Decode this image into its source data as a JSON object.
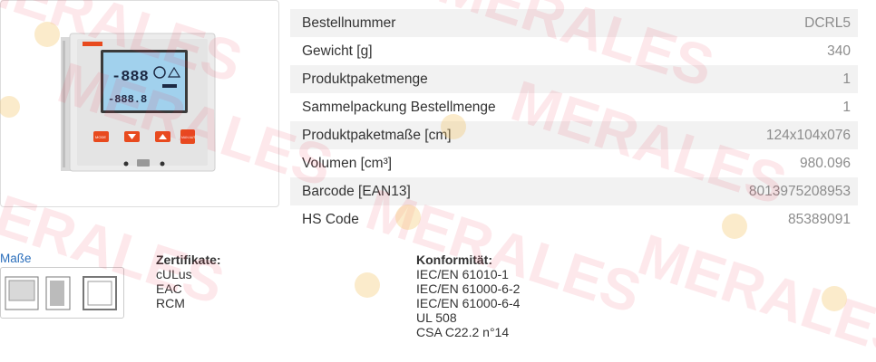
{
  "product_image": {
    "icon": "rcd-controller-device-image"
  },
  "specs": [
    {
      "label": "Bestellnummer",
      "value": "DCRL5"
    },
    {
      "label": "Gewicht [g]",
      "value": "340"
    },
    {
      "label": "Produktpaketmenge",
      "value": "1"
    },
    {
      "label": "Sammelpackung Bestellmenge",
      "value": "1"
    },
    {
      "label": "Produktpaketmaße [cm]",
      "value": "124x104x076"
    },
    {
      "label": "Volumen [cm³]",
      "value": "980.096"
    },
    {
      "label": "Barcode [EAN13]",
      "value": "8013975208953"
    },
    {
      "label": "HS Code",
      "value": "85389091"
    }
  ],
  "dimensions": {
    "link_label": "Maße",
    "thumbnail": "dimension-drawing-thumbnail"
  },
  "certificates": {
    "title": "Zertifikate:",
    "items": [
      "cULus",
      "EAC",
      "RCM"
    ]
  },
  "conformity": {
    "title": "Konformität:",
    "items": [
      "IEC/EN 61010-1",
      "IEC/EN 61000-6-2",
      "IEC/EN 61000-6-4",
      "UL 508",
      "CSA C22.2 n°14"
    ]
  },
  "device_display": {
    "top_digits": "-888",
    "bottom_digits": "-888.8",
    "buttons": [
      "MODE",
      "MAN AUT"
    ]
  },
  "watermark": {
    "text": "MERALES",
    "color": "#e8344f"
  },
  "colors": {
    "link": "#2a6ebb",
    "device_button": "#e84a1e",
    "lcd": "#a9d6ef"
  }
}
